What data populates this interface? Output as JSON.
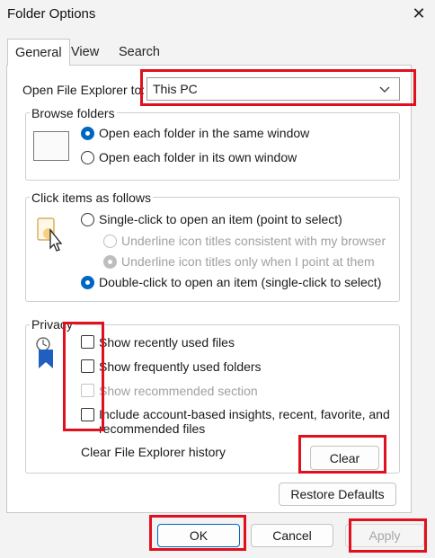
{
  "window": {
    "title": "Folder Options",
    "close_glyph": "✕"
  },
  "tabs": [
    {
      "label": "General",
      "active": true
    },
    {
      "label": "View",
      "active": false
    },
    {
      "label": "Search",
      "active": false
    }
  ],
  "open_in": {
    "label": "Open File Explorer to:",
    "value": "This PC"
  },
  "browse": {
    "title": "Browse folders",
    "options": [
      {
        "label": "Open each folder in the same window",
        "checked": true
      },
      {
        "label": "Open each folder in its own window",
        "checked": false
      }
    ]
  },
  "click_items": {
    "title": "Click items as follows",
    "single": "Single-click to open an item (point to select)",
    "sub_options": [
      {
        "label": "Underline icon titles consistent with my browser",
        "checked": false
      },
      {
        "label": "Underline icon titles only when I point at them",
        "checked": true
      }
    ],
    "double": "Double-click to open an item (single-click to select)"
  },
  "privacy": {
    "title": "Privacy",
    "items": [
      {
        "label": "Show recently used files",
        "enabled": true
      },
      {
        "label": "Show frequently used folders",
        "enabled": true
      },
      {
        "label": "Show recommended section",
        "enabled": false
      },
      {
        "label_line1": "Include account-based insights, recent, favorite, and",
        "label_line2": "recommended files",
        "enabled": true
      }
    ],
    "clear_history_label": "Clear File Explorer history",
    "clear_button": "Clear"
  },
  "restore_defaults": "Restore Defaults",
  "footer": {
    "ok": "OK",
    "cancel": "Cancel",
    "apply": "Apply"
  },
  "colors": {
    "accent": "#0067c0",
    "highlight_box": "#e0101e"
  }
}
